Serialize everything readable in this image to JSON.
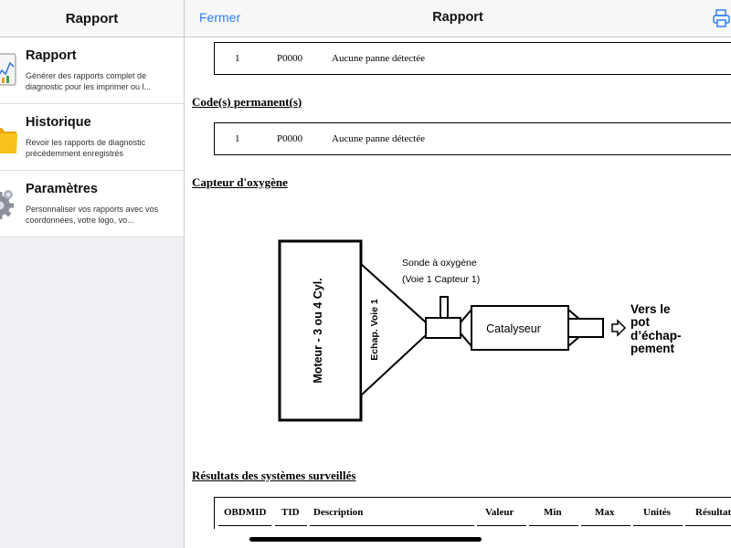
{
  "sidebar": {
    "title": "Rapport",
    "items": [
      {
        "title": "Rapport",
        "desc": "Générer des rapports complet de diagnostic pour les imprimer ou l..."
      },
      {
        "title": "Historique",
        "desc": "Revoir les rapports de diagnostic précédemment enregistrés"
      },
      {
        "title": "Paramètres",
        "desc": "Personnaliser vos rapports avec vos coordonnées, votre logo, vo..."
      }
    ]
  },
  "main": {
    "close_label": "Fermer",
    "title": "Rapport",
    "print_icon": "printer-icon",
    "accent": "#2f7ef6"
  },
  "report": {
    "row1": {
      "num": "1",
      "code": "P0000",
      "text": "Aucune panne détectée"
    },
    "permanent_title": "Code(s) permanent(s)",
    "row2": {
      "num": "1",
      "code": "P0000",
      "text": "Aucune panne détectée"
    },
    "o2_title": "Capteur d'oxygène",
    "diagram": {
      "sensor_line1": "Sonde à oxygène",
      "sensor_line2": "(Voie 1 Capteur 1)",
      "engine": "Moteur - 3 ou 4 Cyl.",
      "exhaust": "Echap. Voie 1",
      "catalyst": "Catalyseur",
      "pipe_line1": "Vers le",
      "pipe_line2": "pot",
      "pipe_line3": "d’échap-",
      "pipe_line4": "pement"
    },
    "results_title": "Résultats des systèmes surveillés",
    "columns": [
      "OBDMID",
      "TID",
      "Description",
      "Valeur",
      "Min",
      "Max",
      "Unités",
      "Résultat"
    ]
  }
}
